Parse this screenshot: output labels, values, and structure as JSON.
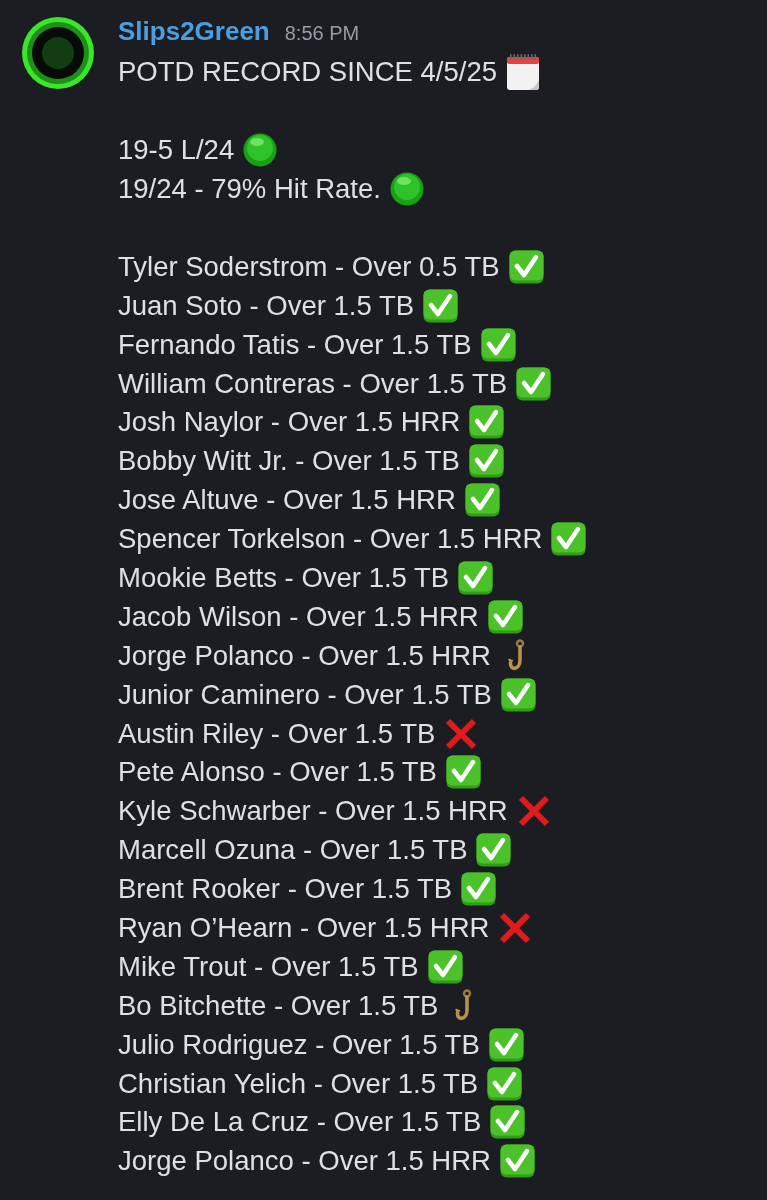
{
  "message": {
    "author": "Slips2Green",
    "timestamp": "8:56 PM",
    "headline": "POTD RECORD SINCE 4/5/25",
    "record_lines": [
      "19-5 L/24",
      "19/24 - 79% Hit Rate."
    ],
    "picks": [
      {
        "text": "Tyler Soderstrom - Over 0.5 TB",
        "kind": "check"
      },
      {
        "text": "Juan Soto - Over 1.5 TB",
        "kind": "check"
      },
      {
        "text": "Fernando Tatis - Over 1.5 TB",
        "kind": "check"
      },
      {
        "text": "William Contreras - Over 1.5 TB",
        "kind": "check"
      },
      {
        "text": "Josh Naylor - Over 1.5 HRR",
        "kind": "check"
      },
      {
        "text": "Bobby Witt Jr. - Over 1.5 TB",
        "kind": "check"
      },
      {
        "text": "Jose Altuve - Over 1.5 HRR",
        "kind": "check"
      },
      {
        "text": "Spencer Torkelson - Over 1.5 HRR",
        "kind": "check"
      },
      {
        "text": "Mookie Betts - Over 1.5 TB",
        "kind": "check"
      },
      {
        "text": "Jacob Wilson - Over 1.5 HRR",
        "kind": "check"
      },
      {
        "text": "Jorge Polanco - Over 1.5 HRR",
        "kind": "hook"
      },
      {
        "text": "Junior Caminero - Over 1.5 TB",
        "kind": "check"
      },
      {
        "text": "Austin Riley - Over 1.5 TB",
        "kind": "cross"
      },
      {
        "text": "Pete Alonso - Over 1.5 TB",
        "kind": "check"
      },
      {
        "text": "Kyle Schwarber - Over 1.5 HRR",
        "kind": "cross"
      },
      {
        "text": "Marcell Ozuna - Over 1.5 TB",
        "kind": "check"
      },
      {
        "text": "Brent Rooker - Over 1.5 TB",
        "kind": "check"
      },
      {
        "text": "Ryan O’Hearn - Over 1.5 HRR",
        "kind": "cross"
      },
      {
        "text": "Mike Trout - Over 1.5 TB",
        "kind": "check"
      },
      {
        "text": "Bo Bitchette - Over 1.5 TB",
        "kind": "hook"
      },
      {
        "text": "Julio Rodriguez - Over 1.5 TB",
        "kind": "check"
      },
      {
        "text": "Christian Yelich - Over 1.5 TB",
        "kind": "check"
      },
      {
        "text": "Elly De La Cruz - Over 1.5 TB",
        "kind": "check"
      },
      {
        "text": "Jorge Polanco - Over 1.5 HRR",
        "kind": "check"
      }
    ]
  }
}
